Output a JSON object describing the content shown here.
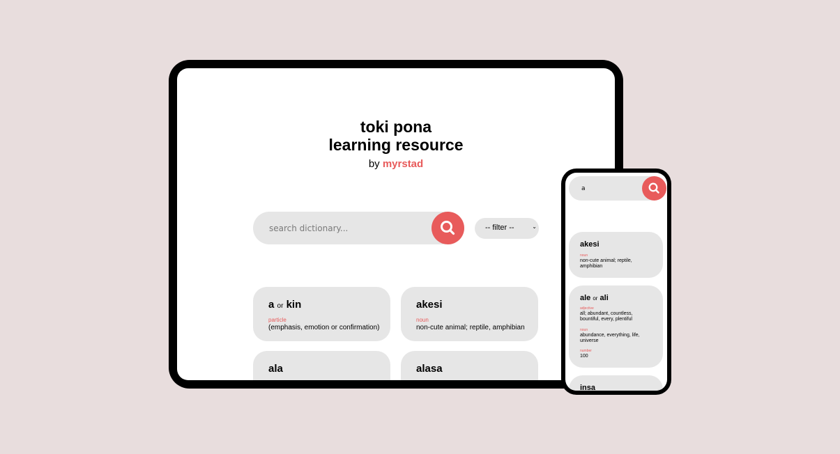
{
  "tablet": {
    "title_line1": "toki pona",
    "title_line2": "learning resource",
    "by_label": "by ",
    "author": "myrstad",
    "search": {
      "placeholder": "search dictionary..."
    },
    "filter": {
      "selected": "-- filter --"
    },
    "cards": [
      {
        "word": "a",
        "or": "or",
        "alt": "kin",
        "pos": "particle",
        "def": "(emphasis, emotion or confirmation)"
      },
      {
        "word": "akesi",
        "pos": "noun",
        "def": "non-cute animal; reptile, amphibian"
      },
      {
        "word": "ala"
      },
      {
        "word": "alasa"
      }
    ]
  },
  "phone": {
    "search": {
      "value": "a"
    },
    "cards": [
      {
        "word": "akesi",
        "senses": [
          {
            "pos": "noun",
            "def": "non-cute animal; reptile, amphibian"
          }
        ]
      },
      {
        "word": "ale",
        "or": "or",
        "alt": "ali",
        "senses": [
          {
            "pos": "adjective",
            "def": "all; abundant, countless, bountiful, every, plentiful"
          },
          {
            "pos": "noun",
            "def": "abundance, everything, life, universe"
          },
          {
            "pos": "number",
            "def": "100"
          }
        ]
      },
      {
        "word": "insa"
      }
    ]
  },
  "colors": {
    "accent": "#e85b5b",
    "background": "#e8dddd",
    "card": "#e6e6e6"
  },
  "icons": {
    "search": "search-icon",
    "filter_chevron": "chevron-down-icon"
  }
}
